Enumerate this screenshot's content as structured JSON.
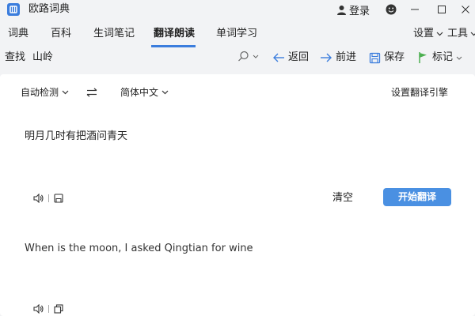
{
  "window": {
    "title": "欧路词典",
    "login_label": "登录",
    "accent_color": "#3b7ddd"
  },
  "tabs": [
    {
      "label": "词典"
    },
    {
      "label": "百科"
    },
    {
      "label": "生词笔记"
    },
    {
      "label": "翻译朗读",
      "active": true
    },
    {
      "label": "单词学习"
    }
  ],
  "right_menu": {
    "settings_label": "设置",
    "tools_label": "工具"
  },
  "toolbar": {
    "search_label": "查找",
    "search_value": "山岭",
    "back_label": "返回",
    "forward_label": "前进",
    "save_label": "保存",
    "bookmark_label": "标记"
  },
  "translate": {
    "source_lang": "自动检测",
    "target_lang": "简体中文",
    "engine_label": "设置翻译引擎",
    "source_text": "明月几时有把酒问青天",
    "clear_label": "清空",
    "start_label": "开始翻译",
    "result_text": "When is the moon, I asked Qingtian for wine",
    "button_color": "#4a90e2"
  }
}
